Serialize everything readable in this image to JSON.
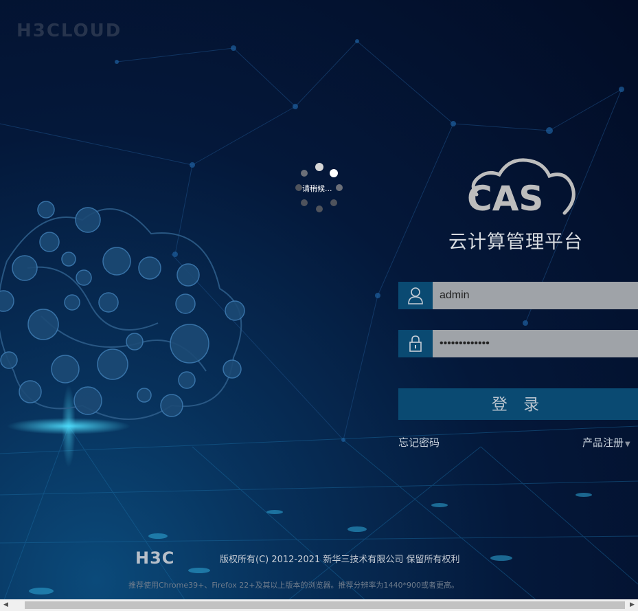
{
  "brand": {
    "logo_text": "H3CLOUD"
  },
  "loading": {
    "text": "请稍候..."
  },
  "product": {
    "logo_text": "CAS",
    "title": "云计算管理平台"
  },
  "login": {
    "username_value": "admin",
    "password_value": "•••••••••••••",
    "submit_label": "登 录",
    "forgot_password": "忘记密码",
    "product_register": "产品注册"
  },
  "footer": {
    "company_logo": "H3C",
    "copyright": "版权所有(C) 2012-2021 新华三技术有限公司 保留所有权利",
    "browser_note": "推荐使用Chrome39+、Firefox 22+及其以上版本的浏览器。推荐分辨率为1440*900或者更高。"
  },
  "colors": {
    "accent": "#0a4a72",
    "input_bg": "#9fa3a8",
    "background_dark": "#020c25"
  },
  "icons": [
    "user-icon",
    "lock-icon",
    "caret-down-icon"
  ]
}
